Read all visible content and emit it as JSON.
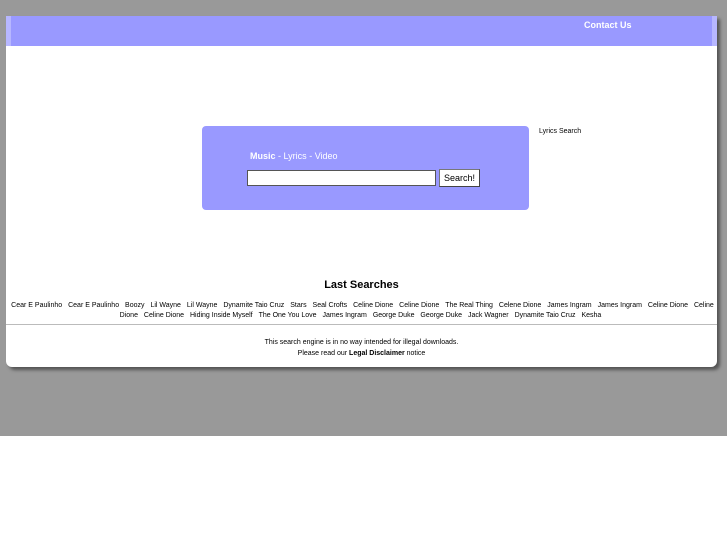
{
  "header": {
    "contact_label": "Contact Us"
  },
  "search": {
    "nav": {
      "music": "Music",
      "sep1": " - ",
      "lyrics": "Lyrics",
      "sep2": " - ",
      "video": "Video"
    },
    "input_value": "",
    "button_label": "Search!"
  },
  "side_label": "Lyrics Search",
  "last_searches": {
    "title": "Last Searches",
    "items": [
      "Cear E Paulinho",
      "Cear E Paulinho",
      "Boozy",
      "Lil Wayne",
      "Lil Wayne",
      "Dynamite Taio Cruz",
      "Stars",
      "Seal Crofts",
      "Celine Dione",
      "Celine Dione",
      "The Real Thing",
      "Celene Dione",
      "James Ingram",
      "James Ingram",
      "Celine Dione",
      "Celine Dione",
      "Celine Dione",
      "Hiding Inside Myself",
      "The One You Love",
      "James Ingram",
      "George Duke",
      "George Duke",
      "Jack Wagner",
      "Dynamite Taio Cruz",
      "Kesha"
    ]
  },
  "footer": {
    "line1": "This search engine is in no way intended for illegal downloads.",
    "line2_prefix": "Please read our ",
    "line2_link": "Legal Disclaimer",
    "line2_suffix": " notice"
  },
  "colors": {
    "accent": "#9999ff",
    "background": "#999999"
  }
}
